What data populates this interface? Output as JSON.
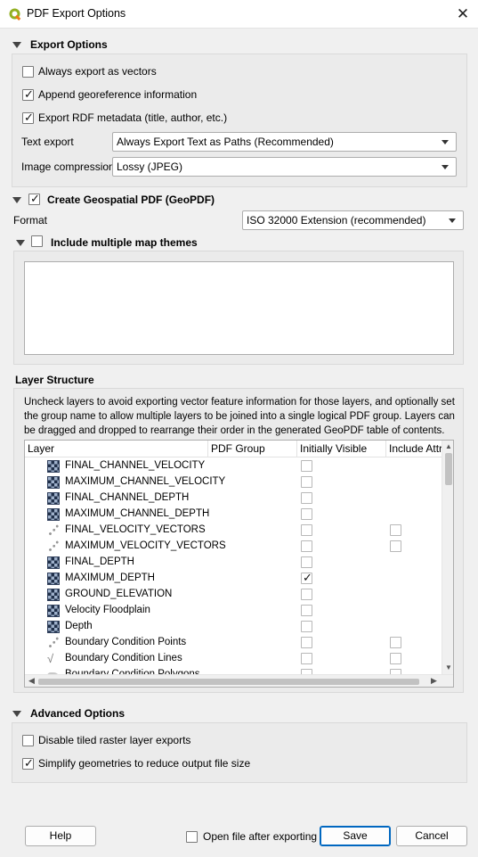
{
  "window": {
    "title": "PDF Export Options"
  },
  "export_options": {
    "header": "Export Options",
    "always_vectors": {
      "label": "Always export as vectors",
      "checked": false
    },
    "append_georef": {
      "label": "Append georeference information",
      "checked": true
    },
    "export_rdf": {
      "label": "Export RDF metadata (title, author, etc.)",
      "checked": true
    },
    "text_export": {
      "label": "Text export",
      "value": "Always Export Text as Paths (Recommended)"
    },
    "image_compression": {
      "label": "Image compression",
      "value": "Lossy (JPEG)"
    }
  },
  "geopdf": {
    "header": "Create Geospatial PDF (GeoPDF)",
    "checked": true,
    "format_label": "Format",
    "format_value": "ISO 32000 Extension (recommended)",
    "themes_header": "Include multiple map themes",
    "themes_checked": false
  },
  "layer_structure": {
    "header": "Layer Structure",
    "description": "Uncheck layers to avoid exporting vector feature information for those layers, and optionally set the group name to allow multiple layers to be joined into a single logical PDF group. Layers can be dragged and dropped to rearrange their order in the generated GeoPDF table of contents.",
    "columns": [
      "Layer",
      "PDF Group",
      "Initially Visible",
      "Include Attri"
    ],
    "rows": [
      {
        "name": "FINAL_CHANNEL_VELOCITY",
        "icon": "raster-icon",
        "visible": false,
        "attr": null
      },
      {
        "name": "MAXIMUM_CHANNEL_VELOCITY",
        "icon": "raster-icon",
        "visible": false,
        "attr": null
      },
      {
        "name": "FINAL_CHANNEL_DEPTH",
        "icon": "raster-icon",
        "visible": false,
        "attr": null
      },
      {
        "name": "MAXIMUM_CHANNEL_DEPTH",
        "icon": "raster-icon",
        "visible": false,
        "attr": null
      },
      {
        "name": "FINAL_VELOCITY_VECTORS",
        "icon": "point-layer-icon",
        "visible": false,
        "attr": false
      },
      {
        "name": "MAXIMUM_VELOCITY_VECTORS",
        "icon": "point-layer-icon",
        "visible": false,
        "attr": false
      },
      {
        "name": "FINAL_DEPTH",
        "icon": "raster-icon",
        "visible": false,
        "attr": null
      },
      {
        "name": "MAXIMUM_DEPTH",
        "icon": "raster-icon",
        "visible": true,
        "attr": null
      },
      {
        "name": "GROUND_ELEVATION",
        "icon": "raster-icon",
        "visible": false,
        "attr": null
      },
      {
        "name": "Velocity Floodplain",
        "icon": "raster-icon",
        "visible": false,
        "attr": null
      },
      {
        "name": "Depth",
        "icon": "raster-icon",
        "visible": false,
        "attr": null
      },
      {
        "name": "Boundary Condition Points",
        "icon": "point-layer-icon",
        "visible": false,
        "attr": false
      },
      {
        "name": "Boundary Condition Lines",
        "icon": "line-layer-icon",
        "visible": false,
        "attr": false
      },
      {
        "name": "Boundary Condition Polygons",
        "icon": "polygon-layer-icon",
        "visible": false,
        "attr": false
      }
    ]
  },
  "advanced_options": {
    "header": "Advanced Options",
    "disable_tiled": {
      "label": "Disable tiled raster layer exports",
      "checked": false
    },
    "simplify": {
      "label": "Simplify geometries to reduce output file size",
      "checked": true
    }
  },
  "footer": {
    "help": "Help",
    "open_after": {
      "label": "Open file after exporting",
      "checked": false
    },
    "save": "Save",
    "cancel": "Cancel"
  }
}
